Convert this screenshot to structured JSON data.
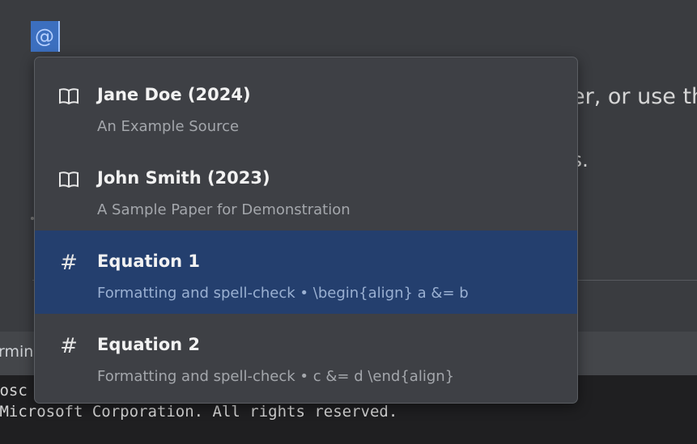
{
  "editor": {
    "token_glyph": "@",
    "fragment_1": "er, or use th",
    "fragment_2": "s."
  },
  "panel": {
    "tab_label": "rmin"
  },
  "terminal": {
    "line_1": "rosc",
    "line_2": " Microsoft Corporation. All rights reserved."
  },
  "popup": {
    "items": [
      {
        "icon": "book-icon",
        "glyph": "🕮",
        "title": "Jane Doe (2024)",
        "subtitle": "An Example Source",
        "selected": false
      },
      {
        "icon": "book-icon",
        "glyph": "🕮",
        "title": "John Smith (2023)",
        "subtitle": "A Sample Paper for Demonstration",
        "selected": false
      },
      {
        "icon": "hash-icon",
        "glyph": "#",
        "title": "Equation 1",
        "subtitle": "Formatting and spell-check • \\begin{align} a &= b",
        "selected": true
      },
      {
        "icon": "hash-icon",
        "glyph": "#",
        "title": "Equation 2",
        "subtitle": "Formatting and spell-check • c &= d \\end{align}",
        "selected": false
      }
    ]
  },
  "colors": {
    "editor_bg": "#3a3c40",
    "popup_bg": "#3e4045",
    "selection_bg": "#243f6e",
    "terminal_bg": "#1f1f21",
    "token_bg": "#3c6fbf"
  }
}
